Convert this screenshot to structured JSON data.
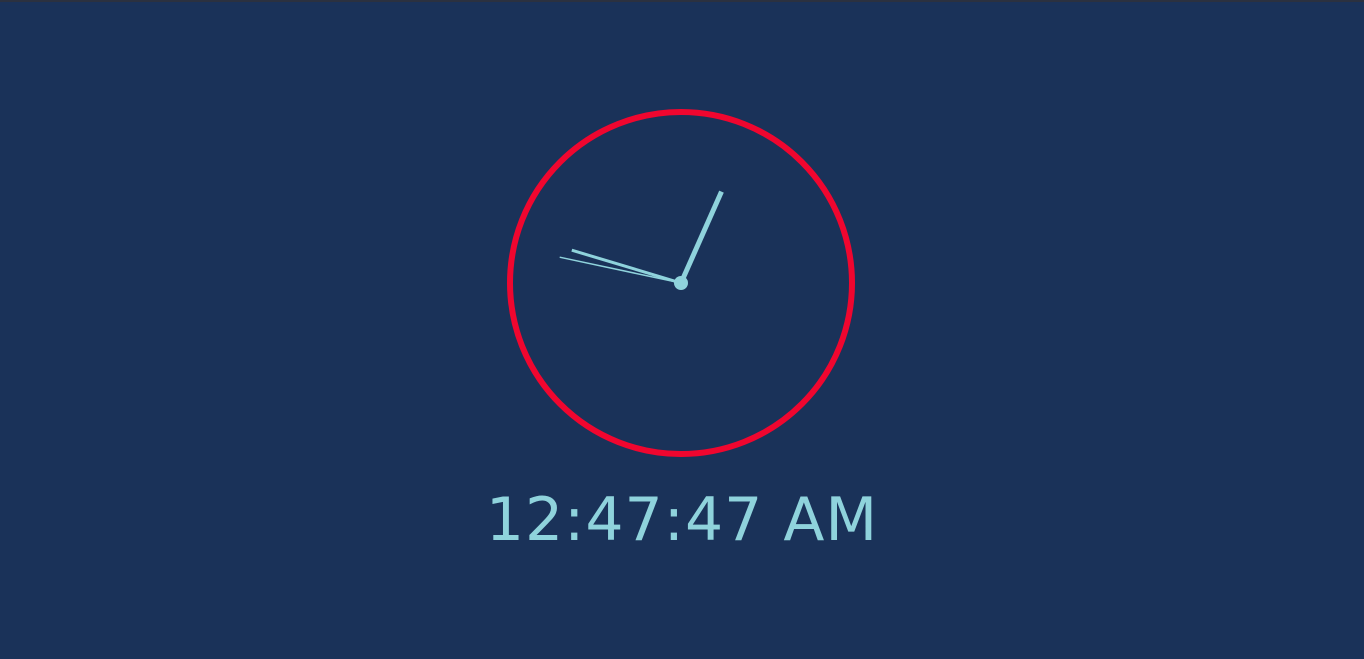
{
  "colors": {
    "background": "#1a3259",
    "ring": "#f0062f",
    "hands": "#8fd3dc",
    "readout": "#8fd3dc"
  },
  "clock": {
    "hours": 12,
    "minutes": 47,
    "seconds": 47,
    "time_text": "12:47:47 AM"
  }
}
